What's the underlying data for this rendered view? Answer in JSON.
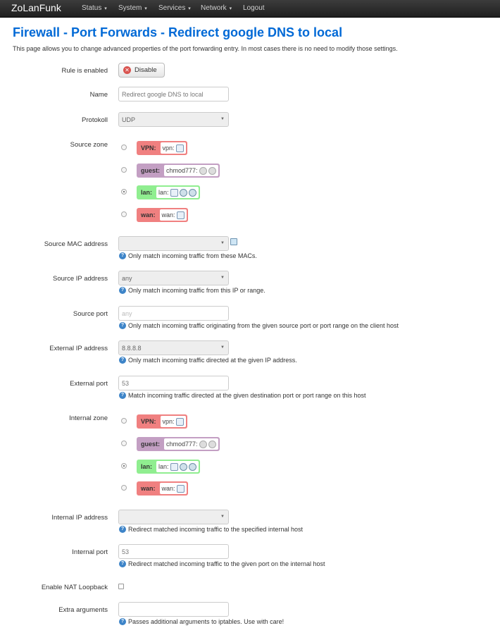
{
  "nav": {
    "brand": "ZoLanFunk",
    "items": [
      "Status",
      "System",
      "Services",
      "Network",
      "Logout"
    ]
  },
  "page": {
    "title": "Firewall - Port Forwards - Redirect google DNS to local",
    "description": "This page allows you to change advanced properties of the port forwarding entry. In most cases there is no need to modify those settings."
  },
  "form": {
    "rule_enabled": {
      "label": "Rule is enabled",
      "button": "Disable"
    },
    "name": {
      "label": "Name",
      "placeholder": "Redirect google DNS to local"
    },
    "protocol": {
      "label": "Protokoll",
      "value": "UDP"
    },
    "source_zone": {
      "label": "Source zone"
    },
    "source_mac": {
      "label": "Source MAC address",
      "value": "",
      "help": "Only match incoming traffic from these MACs."
    },
    "source_ip": {
      "label": "Source IP address",
      "value": "any",
      "help": "Only match incoming traffic from this IP or range."
    },
    "source_port": {
      "label": "Source port",
      "placeholder": "any",
      "help": "Only match incoming traffic originating from the given source port or port range on the client host"
    },
    "external_ip": {
      "label": "External IP address",
      "value": "8.8.8.8",
      "help": "Only match incoming traffic directed at the given IP address."
    },
    "external_port": {
      "label": "External port",
      "value": "53",
      "help": "Match incoming traffic directed at the given destination port or port range on this host"
    },
    "internal_zone": {
      "label": "Internal zone"
    },
    "internal_ip": {
      "label": "Internal IP address",
      "value": "",
      "help": "Redirect matched incoming traffic to the specified internal host"
    },
    "internal_port": {
      "label": "Internal port",
      "value": "53",
      "help": "Redirect matched incoming traffic to the given port on the internal host"
    },
    "nat_loopback": {
      "label": "Enable NAT Loopback",
      "checked": false
    },
    "extra_args": {
      "label": "Extra arguments",
      "value": "",
      "help": "Passes additional arguments to iptables. Use with care!"
    }
  },
  "zones": [
    {
      "name": "VPN:",
      "net": "vpn:",
      "color": "#f08080",
      "selected": false,
      "icons": [
        "network-icon"
      ]
    },
    {
      "name": "guest:",
      "net": "chmod777:",
      "color": "#c39fc3",
      "selected": false,
      "icons": [
        "wifi-off-icon",
        "wifi-off-icon"
      ]
    },
    {
      "name": "lan:",
      "net": "lan:",
      "color": "#90ee90",
      "selected": true,
      "icons": [
        "network-icon",
        "wifi-icon",
        "wifi-icon"
      ]
    },
    {
      "name": "wan:",
      "net": "wan:",
      "color": "#f08080",
      "selected": false,
      "icons": [
        "network-icon"
      ]
    }
  ],
  "colors": {
    "title": "#0069d6",
    "navbar": "#222222",
    "help_icon": "#3d84c8"
  }
}
